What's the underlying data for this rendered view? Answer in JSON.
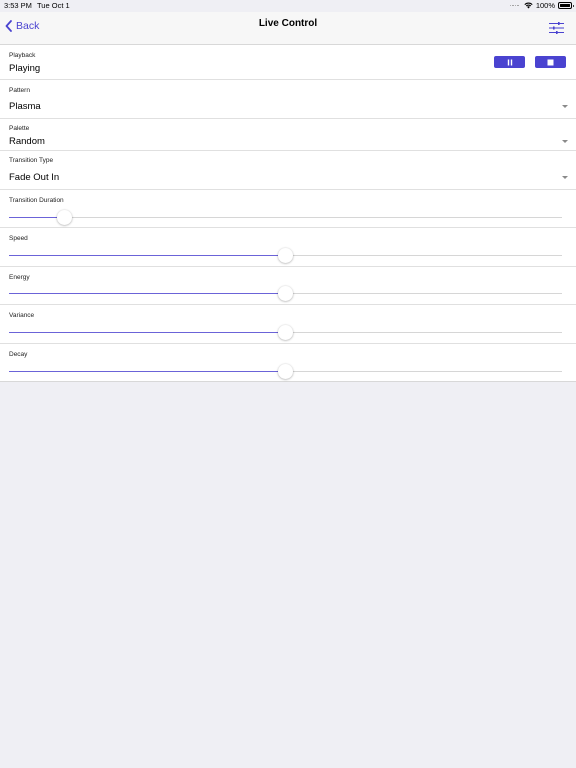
{
  "status_bar": {
    "time": "3:53 PM",
    "date": "Tue Oct 1",
    "battery": "100%"
  },
  "nav": {
    "back_label": "Back",
    "title": "Live Control",
    "back_icon": "chevron-left-icon",
    "settings_icon": "sliders-icon"
  },
  "playback": {
    "label": "Playback",
    "value": "Playing",
    "pause_icon": "pause-icon",
    "stop_icon": "stop-icon"
  },
  "pattern": {
    "label": "Pattern",
    "value": "Plasma"
  },
  "palette": {
    "label": "Palette",
    "value": "Random"
  },
  "transition_type": {
    "label": "Transition Type",
    "value": "Fade Out In"
  },
  "sliders": [
    {
      "label": "Transition Duration",
      "value": 0.1
    },
    {
      "label": "Speed",
      "value": 0.5
    },
    {
      "label": "Energy",
      "value": 0.5
    },
    {
      "label": "Variance",
      "value": 0.5
    },
    {
      "label": "Decay",
      "value": 0.5
    }
  ],
  "colors": {
    "accent": "#4a43d0",
    "slider_fill": "#6b63d8",
    "background": "#efeff4"
  }
}
